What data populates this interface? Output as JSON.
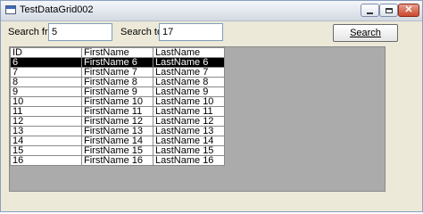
{
  "window": {
    "title": "TestDataGrid002"
  },
  "search": {
    "from_label": "Search from:",
    "from_value": "5",
    "to_label": "Search to:",
    "to_value": "17",
    "button_label": "Search"
  },
  "grid": {
    "columns": [
      "ID",
      "FirstName",
      "LastName"
    ],
    "selected_row": 0,
    "rows": [
      [
        "6",
        "FirstName 6",
        "LastName 6"
      ],
      [
        "7",
        "FirstName 7",
        "LastName 7"
      ],
      [
        "8",
        "FirstName 8",
        "LastName 8"
      ],
      [
        "9",
        "FirstName 9",
        "LastName 9"
      ],
      [
        "10",
        "FirstName 10",
        "LastName 10"
      ],
      [
        "11",
        "FirstName 11",
        "LastName 11"
      ],
      [
        "12",
        "FirstName 12",
        "LastName 12"
      ],
      [
        "13",
        "FirstName 13",
        "LastName 13"
      ],
      [
        "14",
        "FirstName 14",
        "LastName 14"
      ],
      [
        "15",
        "FirstName 15",
        "LastName 15"
      ],
      [
        "16",
        "FirstName 16",
        "LastName 16"
      ]
    ]
  }
}
